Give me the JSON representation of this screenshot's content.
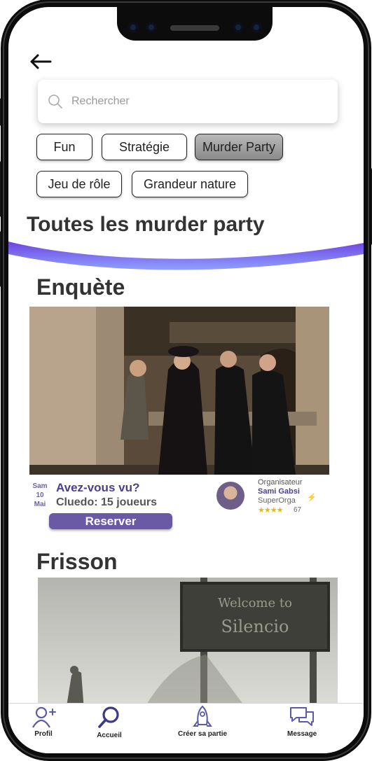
{
  "search": {
    "placeholder": "Rechercher"
  },
  "filters": [
    {
      "label": "Fun",
      "active": false
    },
    {
      "label": "Stratégie",
      "active": false
    },
    {
      "label": "Murder Party",
      "active": true
    },
    {
      "label": "Jeu de rôle",
      "active": false
    },
    {
      "label": "Grandeur nature",
      "active": false
    }
  ],
  "page_title": "Toutes les murder party",
  "sections": [
    {
      "title": "Enquète",
      "event": {
        "date": {
          "day_name": "Sam",
          "day": "10",
          "month": "Mai"
        },
        "title": "Avez-vous vu?",
        "subtitle": "Cluedo: 15 joueurs",
        "reserve_label": "Reserver",
        "organizer": {
          "label": "Organisateur",
          "name": "Sami Gabsi",
          "role": "SuperOrga",
          "stars": "★★★★",
          "rating_count": "67",
          "badge_icon": "lightning-icon"
        }
      }
    },
    {
      "title": "Frisson",
      "sign_text": [
        "Welcome to",
        "Silencio"
      ]
    }
  ],
  "tabbar": [
    {
      "label": "Profil",
      "icon": "user-plus-icon"
    },
    {
      "label": "Accueil",
      "icon": "search-icon"
    },
    {
      "label": "Créer sa partie",
      "icon": "rocket-icon"
    },
    {
      "label": "Message",
      "icon": "chat-icon"
    }
  ],
  "colors": {
    "accent": "#6a5aa6",
    "accent_dark": "#4a3f8c",
    "wave_top": "#6d44e0",
    "wave_bottom": "#8fa0ff"
  }
}
